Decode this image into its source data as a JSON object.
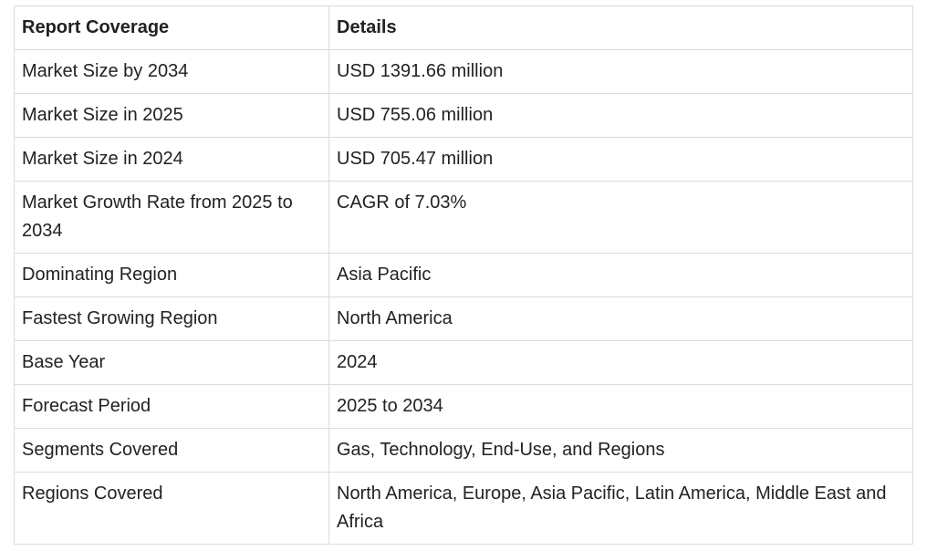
{
  "table": {
    "headers": [
      "Report Coverage",
      "Details"
    ],
    "rows": [
      [
        "Market Size by 2034",
        "USD 1391.66 million"
      ],
      [
        "Market Size in 2025",
        "USD 755.06 million"
      ],
      [
        "Market Size in 2024",
        "USD 705.47 million"
      ],
      [
        "Market Growth Rate from 2025 to 2034",
        "CAGR of 7.03%"
      ],
      [
        "Dominating Region",
        "Asia Pacific"
      ],
      [
        "Fastest Growing Region",
        "North America"
      ],
      [
        "Base Year",
        "2024"
      ],
      [
        "Forecast Period",
        "2025 to 2034"
      ],
      [
        "Segments Covered",
        "Gas, Technology, End-Use, and Regions"
      ],
      [
        "Regions Covered",
        "North America, Europe, Asia Pacific, Latin America, Middle East and Africa"
      ]
    ]
  }
}
